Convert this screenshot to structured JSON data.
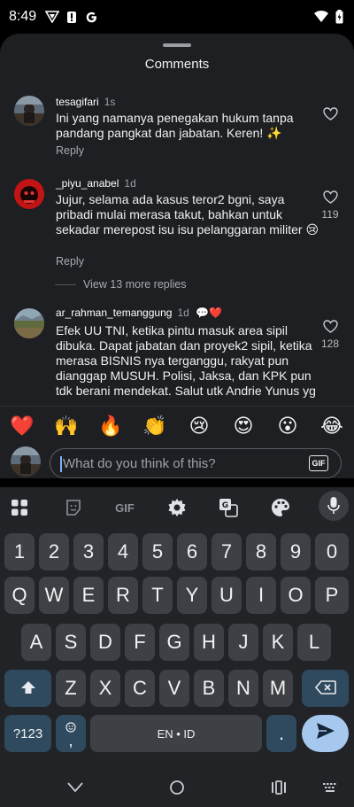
{
  "status_bar": {
    "time": "8:49"
  },
  "sheet": {
    "title": "Comments"
  },
  "comments": [
    {
      "username": "tesagifari",
      "time": "1s",
      "text": "Ini yang namanya penegakan hukum tanpa pandang pangkat dan jabatan. Keren! ✨",
      "reply_label": "Reply",
      "likes": ""
    },
    {
      "username": "_piyu_anabel",
      "time": "1d",
      "text": "Jujur, selama ada kasus teror2 bgni, saya pribadi mulai merasa takut, bahkan untuk sekadar merepost isu isu pelanggaran militer 😢",
      "reply_label": "Reply",
      "likes": "119",
      "view_more": "View 13 more replies"
    },
    {
      "username": "ar_rahman_temanggung",
      "time": "1d",
      "badge": "💬❤️",
      "text": "Efek UU TNI, ketika pintu masuk area sipil dibuka. Dapat jabatan dan proyek2 sipil, ketika merasa BISNIS nya terganggu, rakyat pun dianggap MUSUH. Polisi, Jaksa, dan KPK pun tdk berani mendekat. Salut utk Andrie Yunus yg berani bersuara. Jadi ini",
      "likes": "128"
    }
  ],
  "emoji_bar": [
    "❤️",
    "🙌",
    "🔥",
    "👏",
    "😢",
    "😍",
    "😮",
    "😂"
  ],
  "input": {
    "placeholder": "What do you think of this?",
    "gif_label": "GIF"
  },
  "keyboard": {
    "toolbar": {
      "gif_label": "GIF"
    },
    "row_numbers": [
      "1",
      "2",
      "3",
      "4",
      "5",
      "6",
      "7",
      "8",
      "9",
      "0"
    ],
    "row1": [
      "Q",
      "W",
      "E",
      "R",
      "T",
      "Y",
      "U",
      "I",
      "O",
      "P"
    ],
    "row2": [
      "A",
      "S",
      "D",
      "F",
      "G",
      "H",
      "J",
      "K",
      "L"
    ],
    "row3": [
      "Z",
      "X",
      "C",
      "V",
      "B",
      "N",
      "M"
    ],
    "symbols_label": "?123",
    "emoji_comma": ",",
    "space_label": "EN • ID",
    "period": "."
  }
}
